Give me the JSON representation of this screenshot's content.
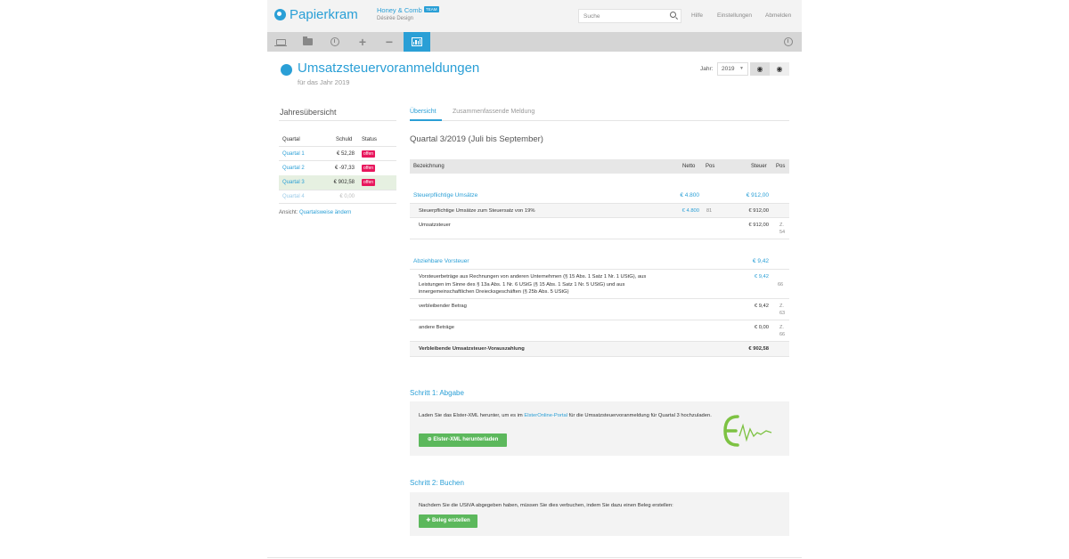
{
  "header": {
    "logo_text": "Papierkram",
    "company": "Honey & Comb",
    "team_badge": "TEAM",
    "company_sub": "Désirée Design",
    "search_placeholder": "Suche",
    "links": [
      "Hilfe",
      "Einstellungen",
      "Abmelden"
    ]
  },
  "page": {
    "title": "Umsatzsteuervoranmeldungen",
    "subtitle": "für das Jahr 2019",
    "year_label": "Jahr:",
    "year_value": "2019"
  },
  "sidebar": {
    "title": "Jahresübersicht",
    "headers": {
      "quarter": "Quartal",
      "debt": "Schuld",
      "status": "Status"
    },
    "rows": [
      {
        "quarter": "Quartal 1",
        "amount": "€ 52,28",
        "status": "offen"
      },
      {
        "quarter": "Quartal 2",
        "amount": "€ -97,33",
        "status": "offen"
      },
      {
        "quarter": "Quartal 3",
        "amount": "€ 902,58",
        "status": "offen"
      },
      {
        "quarter": "Quartal 4",
        "amount": "€ 0,00",
        "status": ""
      }
    ],
    "view_label": "Ansicht:",
    "view_link": "Quartalsweise ändern"
  },
  "tabs": {
    "overview": "Übersicht",
    "summary": "Zusammenfassende Meldung"
  },
  "quarter_title": "Quartal 3/2019 (Juli bis September)",
  "table": {
    "headers": {
      "label": "Bezeichnung",
      "net": "Netto",
      "pos": "Pos",
      "tax": "Steuer",
      "pos2": "Pos"
    },
    "s1": {
      "label": "Steuerpflichtige Umsätze",
      "net": "€ 4.800",
      "tax": "€ 912,00"
    },
    "s1r1": {
      "label": "Steuerpflichtige Umsätze zum Steuersatz von 19%",
      "net": "€ 4.800",
      "pos": "81",
      "tax": "€ 912,00"
    },
    "s1r2": {
      "label": "Umsatzsteuer",
      "tax": "€ 912,00",
      "pos2a": "Z.",
      "pos2b": "54"
    },
    "s2": {
      "label": "Abziehbare Vorsteuer",
      "tax": "€ 9,42"
    },
    "s2r1": {
      "label": "Vorsteuerbeträge aus Rechnungen von anderen Unternehmen (§ 15 Abs. 1 Satz 1 Nr. 1 UStG), aus Leistungen im Sinne des § 13a Abs. 1 Nr. 6 UStG (§ 15 Abs. 1 Satz 1 Nr. 5 UStG) und aus innergemeinschaftlichen Dreiecksgeschäften (§ 25b Abs. 5 UStG)",
      "tax": "€ 9,42",
      "pos2": "66"
    },
    "s2r2": {
      "label": "verbleibender Betrag",
      "tax": "€ 9,42",
      "pos2a": "Z.",
      "pos2b": "63"
    },
    "s2r3": {
      "label": "andere Beträge",
      "tax": "€ 0,00",
      "pos2a": "Z.",
      "pos2b": "66"
    },
    "total": {
      "label": "Verbleibende Umsatzsteuer-Vorauszahlung",
      "tax": "€ 902,58"
    }
  },
  "step1": {
    "title": "Schritt 1: Abgabe",
    "text_a": "Laden Sie das Elster-XML herunter, um es im",
    "link": "ElsterOnline-Portal",
    "text_b": "für die Umsatzsteuervoranmeldung für Quartal",
    "text_c": "3 hochzuladen.",
    "button": "Elster-XML herunterladen"
  },
  "step2": {
    "title": "Schritt 2: Buchen",
    "text": "Nachdem Sie die UStVA abgegeben haben, müssen Sie dies verbuchen, indem Sie dazu einen Beleg erstellen:",
    "button": "Beleg erstellen"
  },
  "colors": {
    "accent": "#2a9fd6",
    "badge": "#e8175d",
    "button": "#5cb85c",
    "elster_logo": "#7dc242"
  }
}
